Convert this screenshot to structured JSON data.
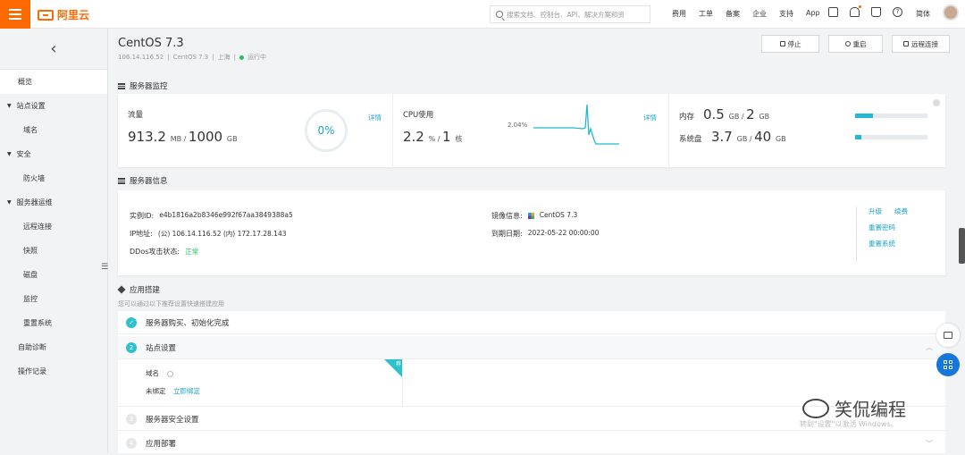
{
  "topbar": {
    "brand": "阿里云",
    "search_placeholder": "搜索文档、控制台、API、解决方案和资",
    "nav": [
      "费用",
      "工单",
      "备案",
      "企业",
      "支持",
      "App"
    ],
    "icons": [
      "screen-icon",
      "bell-icon",
      "cart-icon",
      "help-icon"
    ],
    "lang": "简体"
  },
  "sidebar": {
    "items": [
      {
        "label": "概览",
        "type": "item",
        "active": true
      },
      {
        "label": "站点设置",
        "type": "group"
      },
      {
        "label": "域名",
        "type": "sub"
      },
      {
        "label": "安全",
        "type": "group"
      },
      {
        "label": "防火墙",
        "type": "sub"
      },
      {
        "label": "服务器运维",
        "type": "group"
      },
      {
        "label": "远程连接",
        "type": "sub"
      },
      {
        "label": "快照",
        "type": "sub"
      },
      {
        "label": "磁盘",
        "type": "sub"
      },
      {
        "label": "监控",
        "type": "sub"
      },
      {
        "label": "重置系统",
        "type": "sub"
      },
      {
        "label": "自助诊断",
        "type": "item"
      },
      {
        "label": "操作记录",
        "type": "item"
      }
    ]
  },
  "header": {
    "title": "CentOS 7.3",
    "ip": "106.14.116.52",
    "os": "CentOS 7.3",
    "region": "上海",
    "status": "运行中",
    "buttons": {
      "stop": "停止",
      "restart": "重启",
      "remote": "远程连接"
    }
  },
  "monitor": {
    "section_title": "服务器监控",
    "traffic": {
      "label": "流量",
      "used": "913.2",
      "unit1": "MB",
      "total": "1000",
      "unit2": "GB",
      "percent": "0%",
      "detail": "详情"
    },
    "cpu": {
      "label": "CPU使用",
      "value": "2.2",
      "unit1": "%",
      "cores": "1",
      "unit2": "核",
      "peak": "2.04%",
      "detail": "详情"
    },
    "memory": {
      "label": "内存",
      "used": "0.5",
      "unit1": "GB",
      "total": "2",
      "unit2": "GB",
      "fill": 0.25
    },
    "disk": {
      "label": "系统盘",
      "used": "3.7",
      "unit1": "GB",
      "total": "40",
      "unit2": "GB",
      "fill": 0.09
    }
  },
  "info": {
    "section_title": "服务器信息",
    "instance_label": "实例ID:",
    "instance_id": "e4b1816a2b8346e992f67aa3849388a5",
    "ip_label": "IP地址:",
    "ip_value": "(公) 106.14.116.52 (内) 172.17.28.143",
    "ddos_label": "DDos攻击状态:",
    "ddos_value": "正常",
    "image_label": "镜像信息:",
    "image_value": "CentOS 7.3",
    "expire_label": "到期日期:",
    "expire_value": "2022-05-22 00:00:00",
    "links": {
      "upgrade": "升级",
      "renew": "续费",
      "reset_pwd": "重置密码",
      "reset_sys": "重置系统"
    }
  },
  "apps": {
    "section_title": "应用搭建",
    "subtitle": "您可以通过以下推荐设置快速搭建应用",
    "steps": [
      {
        "num": "✓",
        "label": "服务器购买、初始化完成"
      },
      {
        "num": "2",
        "label": "站点设置"
      },
      {
        "num": "3",
        "label": "服务器安全设置"
      },
      {
        "num": "4",
        "label": "应用部署"
      }
    ],
    "domain_label": "域名",
    "unbound": "未绑定",
    "bind_now": "立即绑定",
    "ribbon": "荐"
  },
  "watermark": {
    "text": "笑侃编程",
    "activate": "转到\"设置\"以激活 Windows。"
  }
}
